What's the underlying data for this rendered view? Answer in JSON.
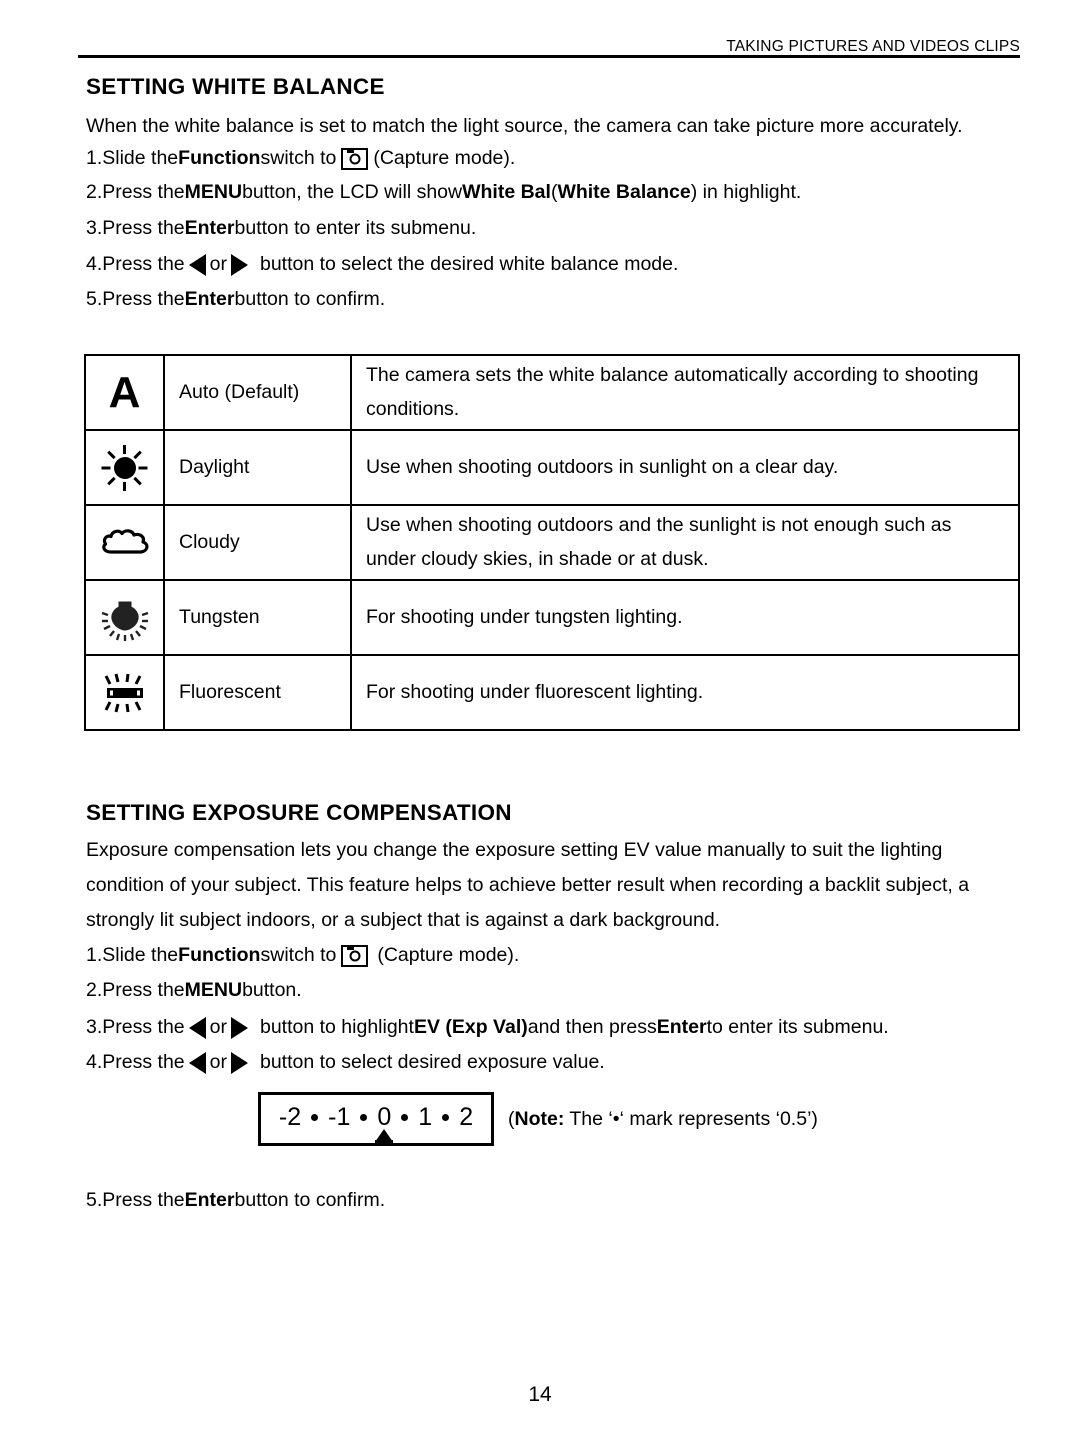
{
  "header": {
    "running_title": "TAKING PICTURES AND VIDEOS CLIPS"
  },
  "white_balance": {
    "heading": "SETTING WHITE BALANCE",
    "intro": "When the white balance is set to match the light source, the camera can take picture more accurately.",
    "steps": [
      {
        "number": "1.",
        "pre": "Slide the ",
        "bold1": "Function",
        "mid": " switch to ",
        "icon": "capture-mode-camera-icon",
        "post": "(Capture mode)."
      },
      {
        "number": "2.",
        "pre": "Press the ",
        "bold1": "MENU",
        "mid": " button, the LCD will show ",
        "bold2": "White Bal",
        "mid2": " (",
        "bold3": "White Balance",
        "post": ") in highlight."
      },
      {
        "number": "3.",
        "pre": "Press the ",
        "bold1": "Enter",
        "post": " button to enter its submenu."
      },
      {
        "number": "4.",
        "pre": "Press the ",
        "icon_left": "arrow-left-icon",
        "mid": "or",
        "icon_right": "arrow-right-icon",
        "post": "button to select the desired white balance mode."
      },
      {
        "number": "5.",
        "pre": " Press the ",
        "bold1": "Enter",
        "post": " button to confirm."
      }
    ],
    "table": {
      "rows": [
        {
          "icon": "letter-a-icon",
          "label": "Auto (Default)",
          "desc_line1": "The camera sets the white balance automatically according to shooting",
          "desc_line2": "conditions."
        },
        {
          "icon": "sun-icon",
          "label": "Daylight",
          "desc_line1": "Use when shooting outdoors in sunlight on a clear day.",
          "desc_line2": ""
        },
        {
          "icon": "cloud-icon",
          "label": "Cloudy",
          "desc_line1": "Use when shooting outdoors and the sunlight is not enough such as",
          "desc_line2": "under cloudy skies, in shade or at dusk."
        },
        {
          "icon": "light-bulb-icon",
          "label": "Tungsten",
          "desc_line1": "For shooting under tungsten lighting.",
          "desc_line2": ""
        },
        {
          "icon": "fluorescent-tube-icon",
          "label": "Fluorescent",
          "desc_line1": "For shooting under fluorescent lighting.",
          "desc_line2": ""
        }
      ]
    }
  },
  "exposure_compensation": {
    "heading": "SETTING EXPOSURE COMPENSATION",
    "paragraph_lines": [
      "Exposure compensation lets you change the exposure setting EV value manually to suit the lighting",
      "condition of your subject. This feature helps to achieve better result when recording a backlit subject, a",
      "strongly lit subject indoors, or a subject that is against a dark background."
    ],
    "steps": [
      {
        "number": "1.",
        "pre": " Slide the ",
        "bold1": "Function",
        "mid": " switch to ",
        "icon": "capture-mode-camera-icon",
        "post": "(Capture mode)."
      },
      {
        "number": "2.",
        "pre": " Press the ",
        "bold1": "MENU",
        "post": " button."
      },
      {
        "number": "3.",
        "pre": " Press the ",
        "icon_left": "arrow-left-icon",
        "mid": "or",
        "icon_right": "arrow-right-icon",
        "post": "button to highlight ",
        "bold2": "EV (Exp Val)",
        "post2": " and then press ",
        "bold3": "Enter",
        "post3": " to enter its submenu."
      },
      {
        "number": "4.",
        "pre": " Press the ",
        "icon_left": "arrow-left-icon",
        "mid": "or",
        "icon_right": "arrow-right-icon",
        "post": "button to select desired exposure value."
      },
      {
        "number": "5.",
        "pre": " Press the ",
        "bold1": "Enter",
        "post": " button to confirm."
      }
    ],
    "ev_scale": {
      "ticks": [
        "-2",
        "-1",
        "0",
        "1",
        "2"
      ],
      "dot_symbol": "•",
      "marker_position_label": "0"
    },
    "note": {
      "open_paren": "(",
      "bold_label": "Note:",
      "text_before": " The ‘",
      "dot": "•",
      "text_after": "‘ mark represents ‘0.5’)"
    }
  },
  "footer": {
    "page_number": "14"
  },
  "colors": {
    "ink": "#000000",
    "paper": "#ffffff"
  }
}
